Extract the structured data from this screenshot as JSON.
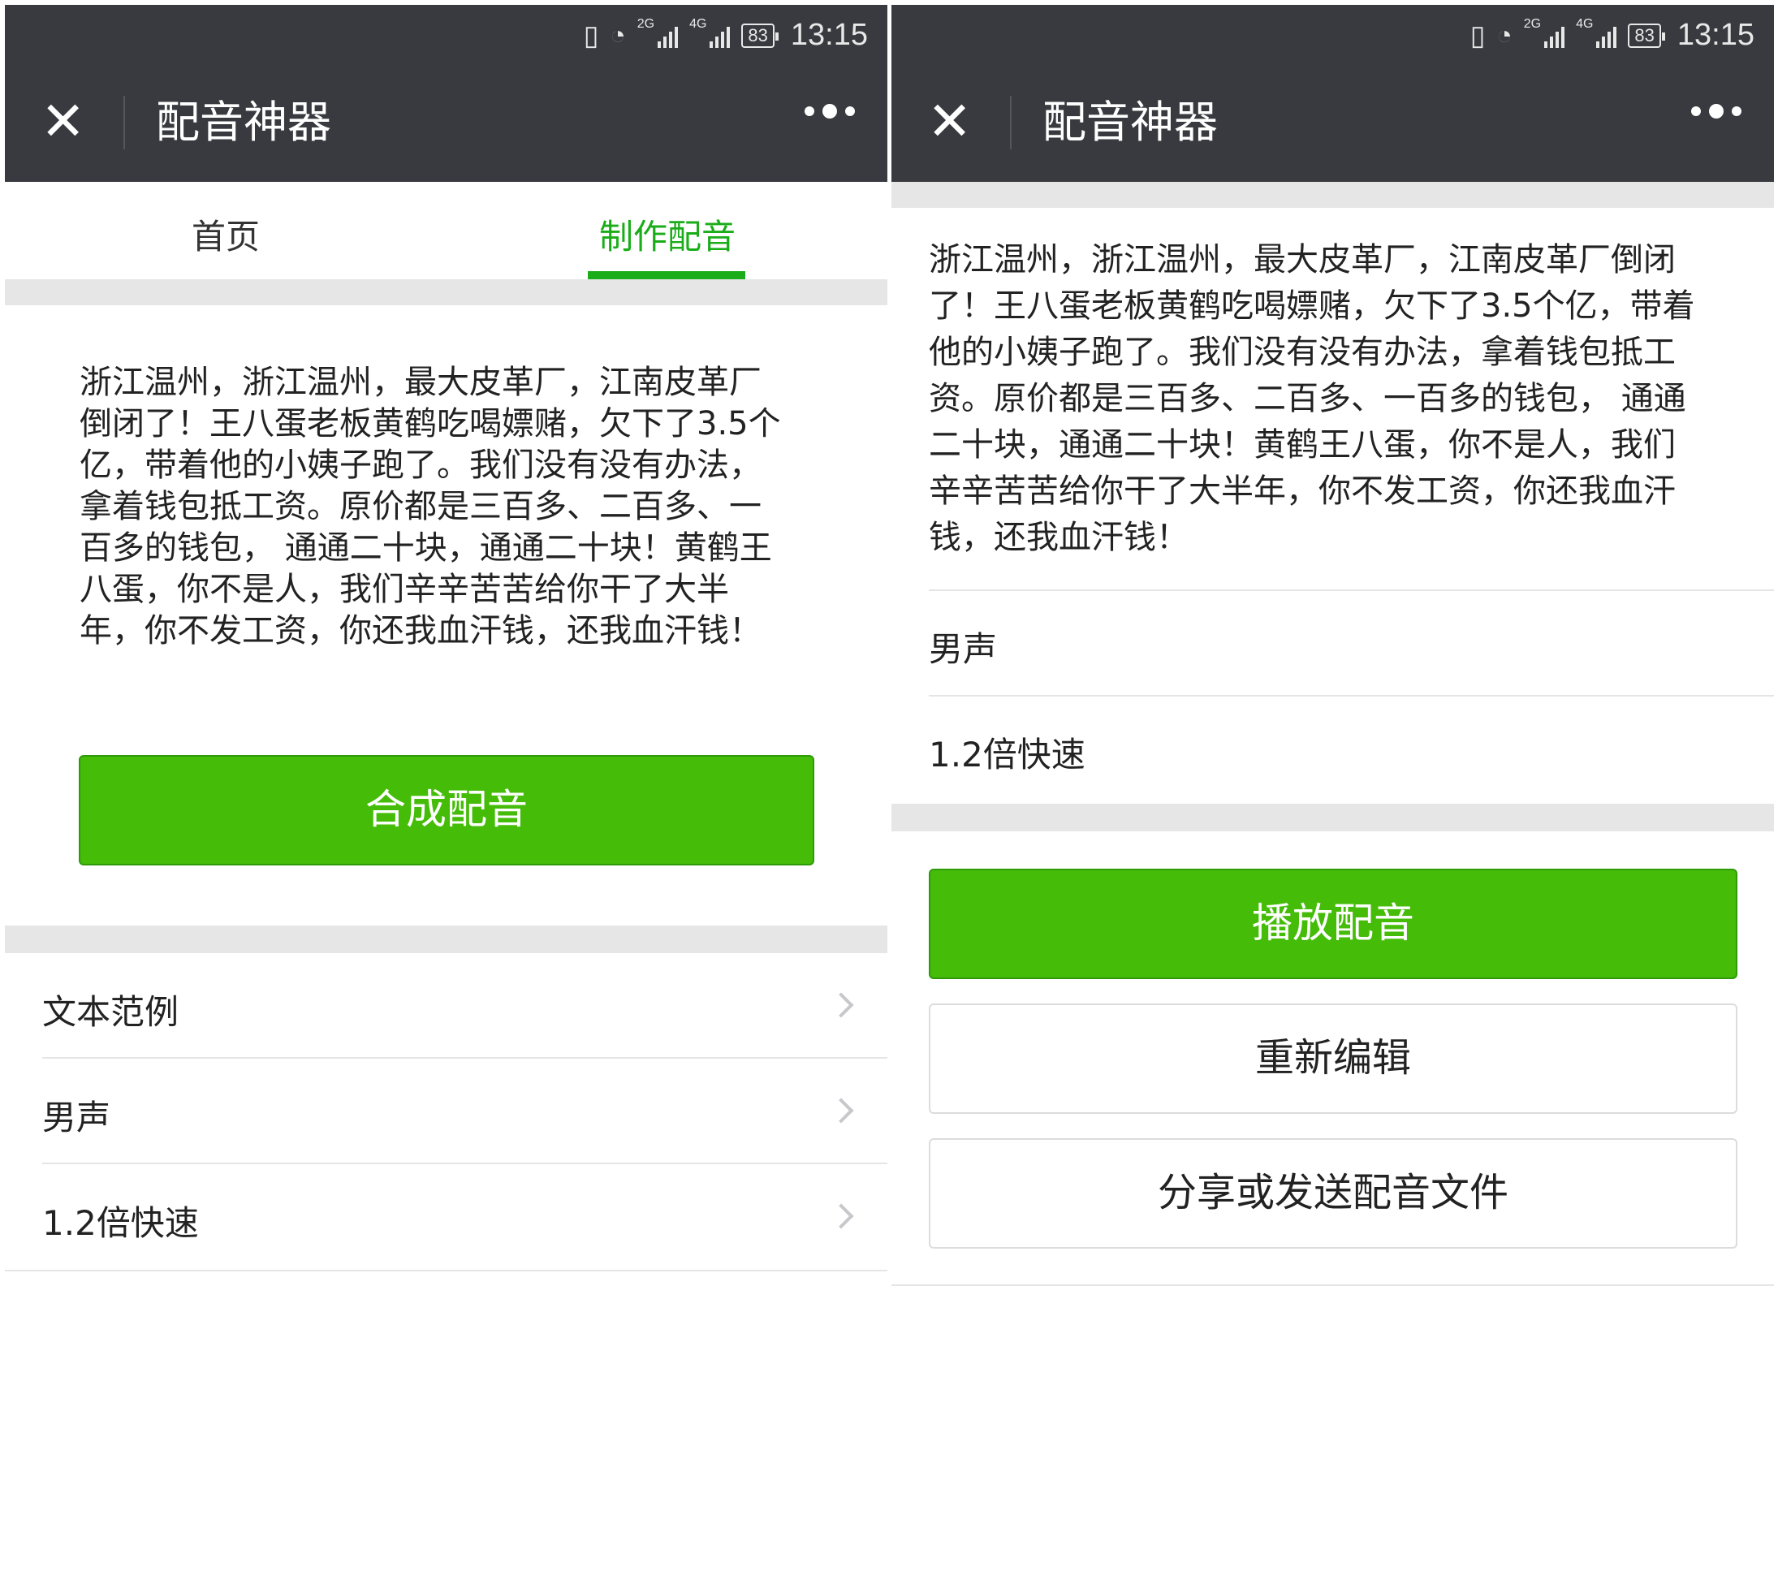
{
  "status_bar": {
    "time": "13:15",
    "battery": "83",
    "net1": "2G",
    "net2": "4G"
  },
  "app": {
    "title": "配音神器",
    "close_icon": "close-icon",
    "more_icon": "more-dots-icon"
  },
  "left": {
    "tabs": [
      {
        "label": "首页",
        "active": false
      },
      {
        "label": "制作配音",
        "active": true
      }
    ],
    "text_lines": [
      "浙江温州，浙江温州，最大皮革厂，江南皮革厂",
      "倒闭了！王八蛋老板黄鹤吃喝嫖赌，欠下了3.5个",
      "亿，带着他的小姨子跑了。我们没有没有办法，",
      "拿着钱包抵工资。原价都是三百多、二百多、一",
      "百多的钱包， 通通二十块，通通二十块！黄鹤王",
      "八蛋，你不是人，我们辛辛苦苦给你干了大半",
      "年，你不发工资，你还我血汗钱，还我血汗钱！"
    ],
    "synth_button": "合成配音",
    "list": [
      {
        "label": "文本范例"
      },
      {
        "label": "男声"
      },
      {
        "label": "1.2倍快速"
      }
    ]
  },
  "right": {
    "text_lines": [
      "浙江温州，浙江温州，最大皮革厂，江南皮革厂倒闭",
      "了！王八蛋老板黄鹤吃喝嫖赌，欠下了3.5个亿，带着",
      "他的小姨子跑了。我们没有没有办法，拿着钱包抵工",
      "资。原价都是三百多、二百多、一百多的钱包， 通通",
      "二十块，通通二十块！黄鹤王八蛋，你不是人，我们",
      "辛辛苦苦给你干了大半年，你不发工资，你还我血汗",
      "钱，还我血汗钱！"
    ],
    "voice": "男声",
    "speed": "1.2倍快速",
    "play_button": "播放配音",
    "reedit_button": "重新编辑",
    "share_button": "分享或发送配音文件"
  },
  "colors": {
    "accent": "#1aad19",
    "button_green": "#44bc08",
    "bar_dark": "#393a3f"
  }
}
